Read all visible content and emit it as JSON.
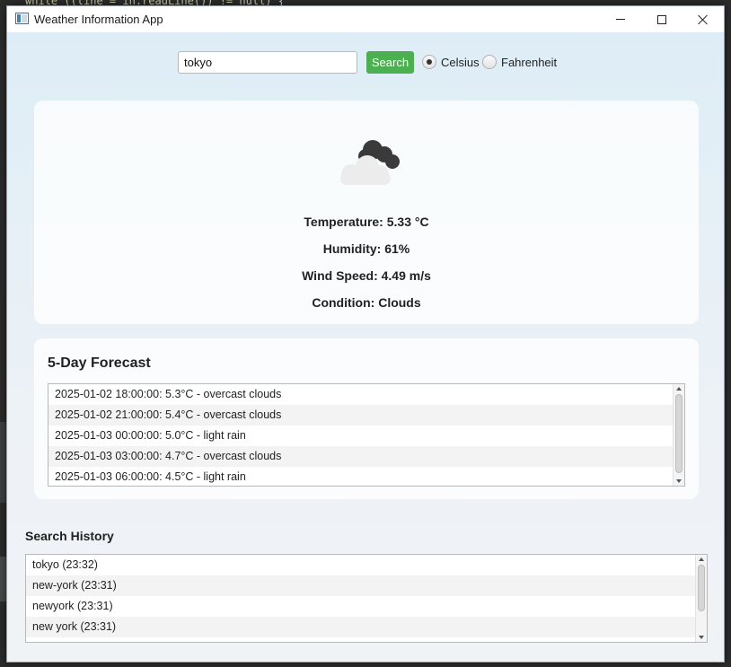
{
  "window": {
    "title": "Weather Information App",
    "icon": "window-app-icon"
  },
  "search": {
    "value": "tokyo",
    "button_label": "Search"
  },
  "units": {
    "options": [
      "Celsius",
      "Fahrenheit"
    ],
    "selected": "Celsius"
  },
  "current": {
    "icon": "cloud-icon",
    "temperature": "Temperature: 5.33 °C",
    "humidity": "Humidity: 61%",
    "wind": "Wind Speed: 4.49 m/s",
    "condition": "Condition: Clouds"
  },
  "forecast": {
    "title": "5-Day Forecast",
    "items": [
      "2025-01-02 18:00:00: 5.3°C - overcast clouds",
      "2025-01-02 21:00:00: 5.4°C - overcast clouds",
      "2025-01-03 00:00:00: 5.0°C - light rain",
      "2025-01-03 03:00:00: 4.7°C - overcast clouds",
      "2025-01-03 06:00:00: 4.5°C - light rain"
    ]
  },
  "history": {
    "title": "Search History",
    "items": [
      "tokyo (23:32)",
      "new-york (23:31)",
      "newyork (23:31)",
      "new york (23:31)"
    ]
  },
  "colors": {
    "search_button": "#4caf50",
    "window_gradient_top": "#dcecf6",
    "window_gradient_bottom": "#f0f3f6"
  }
}
